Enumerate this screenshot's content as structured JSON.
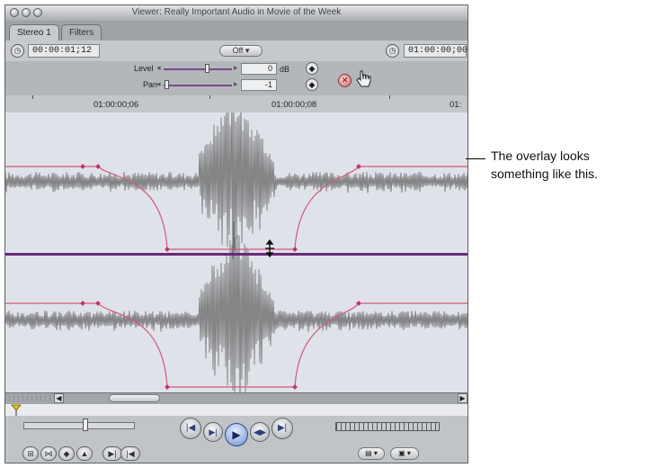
{
  "window": {
    "title": "Viewer: Really Important Audio in Movie of the Week"
  },
  "tabs": [
    {
      "label": "Stereo 1",
      "active": true
    },
    {
      "label": "Filters",
      "active": false
    }
  ],
  "toolbar": {
    "current_timecode": "00:00:01;12",
    "off_button": "Off",
    "duration_timecode": "01:00:00;00"
  },
  "controls": {
    "level": {
      "label": "Level",
      "value": "0",
      "unit": "dB"
    },
    "pan": {
      "label": "Pan",
      "value": "-1"
    }
  },
  "ruler": {
    "ticks": [
      "01:00:00;06",
      "01:00:00;08",
      "01:"
    ]
  },
  "annotation": {
    "text": "The overlay looks something like this."
  },
  "colors": {
    "window_bg": "#b9bcc1",
    "waveform_bg": "#dfe2e8",
    "waveform": "#6e6e6e",
    "overlay": "#d05a7d",
    "divider": "#6a2a7a"
  },
  "icons": [
    "clock-icon",
    "reset-x-icon",
    "pointer-hand-icon",
    "playhead-icon"
  ]
}
